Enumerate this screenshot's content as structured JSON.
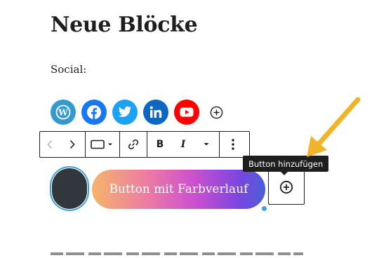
{
  "heading": "Neue Blöcke",
  "social_label": "Social:",
  "social_icons": [
    {
      "name": "wordpress-icon",
      "color": "#3499cd"
    },
    {
      "name": "facebook-icon",
      "color": "#1778f2"
    },
    {
      "name": "twitter-icon",
      "color": "#1da1f2"
    },
    {
      "name": "linkedin-icon",
      "color": "#0d66c2"
    },
    {
      "name": "youtube-icon",
      "color": "#ff0000"
    }
  ],
  "toolbar": {
    "items": [
      "chevron-left-icon",
      "chevron-right-icon",
      "button-style-icon",
      "link-icon",
      "bold",
      "italic",
      "more-formats",
      "options-icon"
    ],
    "bold_label": "B",
    "italic_label": "I"
  },
  "buttons": {
    "dark_button_label": "",
    "gradient_button_label": "Button mit Farbverlauf",
    "add_tooltip": "Button hinzufügen"
  },
  "colors": {
    "accent": "#3ea0e3",
    "dark_button": "#32373c",
    "arrow": "#f0b428"
  }
}
